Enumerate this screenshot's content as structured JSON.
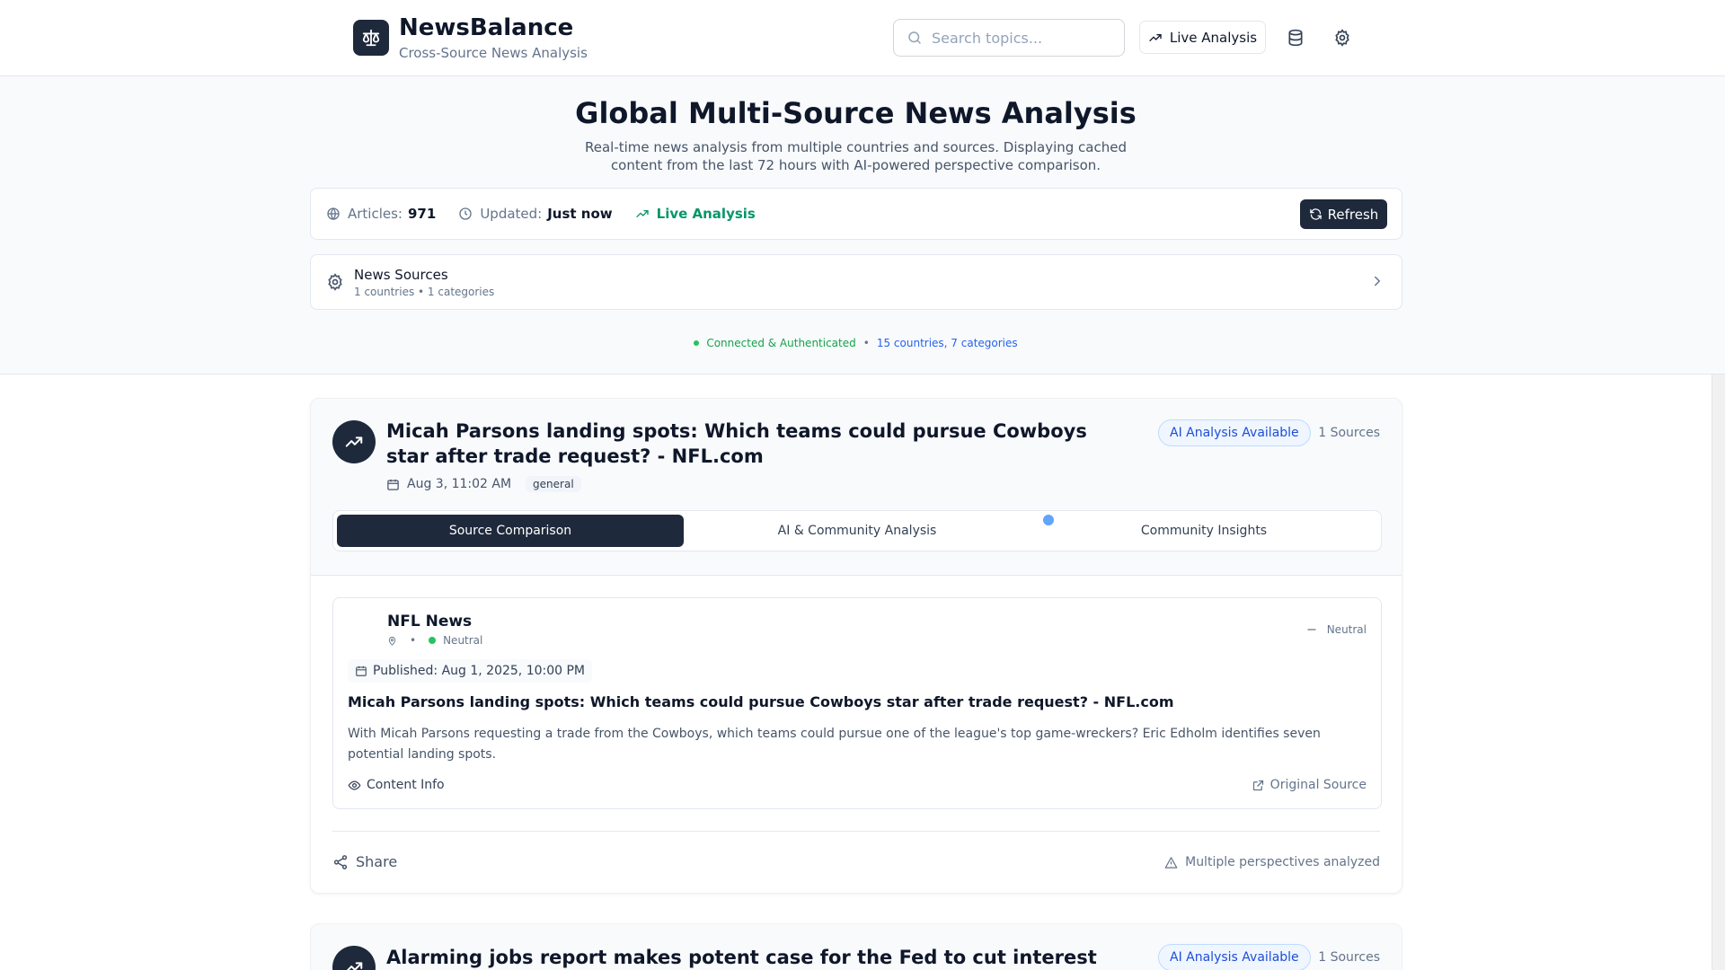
{
  "header": {
    "brand_title": "NewsBalance",
    "brand_subtitle": "Cross-Source News Analysis",
    "search_placeholder": "Search topics...",
    "live_analysis_label": "Live Analysis"
  },
  "hero": {
    "title": "Global Multi-Source News Analysis",
    "description": "Real-time news analysis from multiple countries and sources. Displaying cached content from the last 72 hours with AI-powered perspective comparison."
  },
  "stats": {
    "articles_label": "Articles:",
    "articles_value": "971",
    "updated_label": "Updated:",
    "updated_value": "Just now",
    "live_label": "Live Analysis",
    "refresh_label": "Refresh"
  },
  "sources_panel": {
    "title": "News Sources",
    "subtitle": "1 countries • 1 categories"
  },
  "connection": {
    "status": "Connected & Authenticated",
    "separator": "•",
    "coverage": "15 countries, 7 categories"
  },
  "articles": [
    {
      "title": "Micah Parsons landing spots: Which teams could pursue Cowboys star after trade request? - NFL.com",
      "date": "Aug 3, 11:02 AM",
      "category": "general",
      "ai_badge": "AI Analysis Available",
      "source_count": "1 Sources",
      "tabs": [
        "Source Comparison",
        "AI & Community Analysis",
        "Community Insights"
      ],
      "source": {
        "name": "NFL News",
        "meta_sep": "•",
        "bias": "Neutral",
        "bias_right": "Neutral",
        "published": "Published: Aug 1, 2025, 10:00 PM",
        "headline": "Micah Parsons landing spots: Which teams could pursue Cowboys star after trade request? - NFL.com",
        "excerpt": "With Micah Parsons requesting a trade from the Cowboys, which teams could pursue one of the league's top game-wreckers? Eric Edholm identifies seven potential landing spots.",
        "content_info": "Content Info",
        "original_source": "Original Source"
      },
      "share_label": "Share",
      "perspectives_label": "Multiple perspectives analyzed"
    },
    {
      "title": "Alarming jobs report makes potent case for the Fed to cut interest rates -",
      "ai_badge": "AI Analysis Available",
      "source_count": "1 Sources"
    }
  ]
}
